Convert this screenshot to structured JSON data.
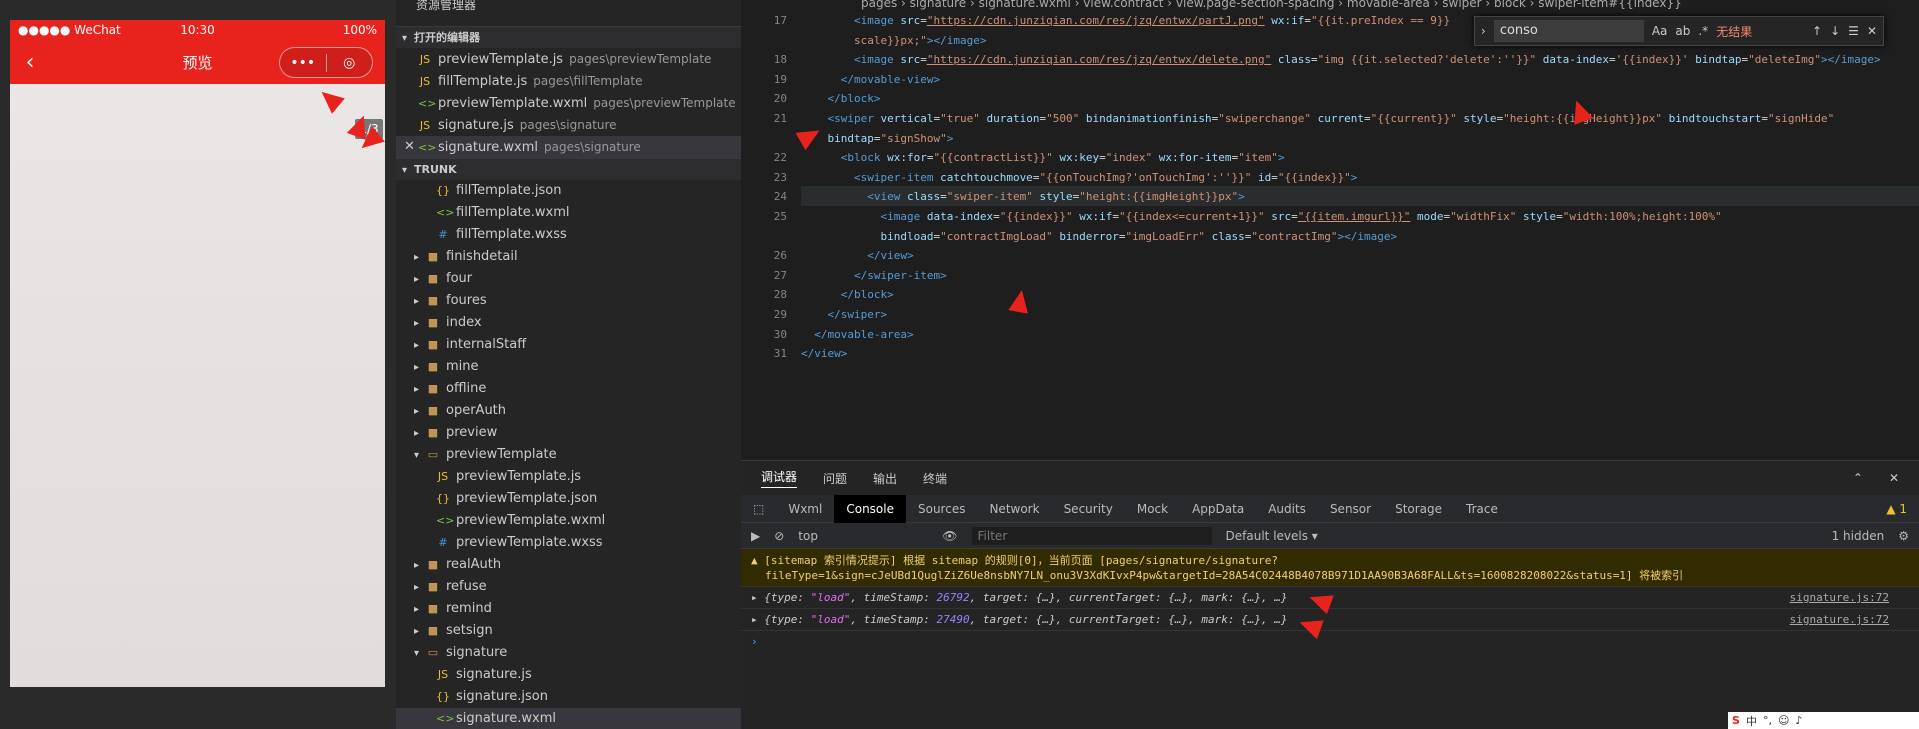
{
  "simulator": {
    "carrier": "●●●●● WeChat",
    "time": "10:30",
    "battery": "100%",
    "title": "预览",
    "capsule_more": "•••",
    "capsule_close": "◎",
    "counter": "1/3"
  },
  "explorer": {
    "title": "资源管理器",
    "open_editors_label": "打开的编辑器",
    "open_editors": [
      {
        "name": "previewTemplate.js",
        "path": "pages\\previewTemplate",
        "type": "js"
      },
      {
        "name": "fillTemplate.js",
        "path": "pages\\fillTemplate",
        "type": "js"
      },
      {
        "name": "previewTemplate.wxml",
        "path": "pages\\previewTemplate",
        "type": "wxml"
      },
      {
        "name": "signature.js",
        "path": "pages\\signature",
        "type": "js"
      },
      {
        "name": "signature.wxml",
        "path": "pages\\signature",
        "type": "wxml"
      }
    ],
    "trunk_label": "TRUNK",
    "tree": [
      {
        "name": "fillTemplate.json",
        "kind": "json",
        "indent": 2
      },
      {
        "name": "fillTemplate.wxml",
        "kind": "wxml",
        "indent": 2
      },
      {
        "name": "fillTemplate.wxss",
        "kind": "wxss",
        "indent": 2
      },
      {
        "name": "finishdetail",
        "kind": "folder",
        "indent": 1
      },
      {
        "name": "four",
        "kind": "folder",
        "indent": 1
      },
      {
        "name": "foures",
        "kind": "folder",
        "indent": 1
      },
      {
        "name": "index",
        "kind": "folder",
        "indent": 1
      },
      {
        "name": "internalStaff",
        "kind": "folder",
        "indent": 1
      },
      {
        "name": "mine",
        "kind": "folder",
        "indent": 1
      },
      {
        "name": "offline",
        "kind": "folder",
        "indent": 1
      },
      {
        "name": "operAuth",
        "kind": "folder",
        "indent": 1
      },
      {
        "name": "preview",
        "kind": "folder",
        "indent": 1
      },
      {
        "name": "previewTemplate",
        "kind": "folder-open",
        "indent": 1
      },
      {
        "name": "previewTemplate.js",
        "kind": "js",
        "indent": 2
      },
      {
        "name": "previewTemplate.json",
        "kind": "json",
        "indent": 2
      },
      {
        "name": "previewTemplate.wxml",
        "kind": "wxml",
        "indent": 2
      },
      {
        "name": "previewTemplate.wxss",
        "kind": "wxss",
        "indent": 2
      },
      {
        "name": "realAuth",
        "kind": "folder",
        "indent": 1
      },
      {
        "name": "refuse",
        "kind": "folder",
        "indent": 1
      },
      {
        "name": "remind",
        "kind": "folder",
        "indent": 1
      },
      {
        "name": "setsign",
        "kind": "folder",
        "indent": 1
      },
      {
        "name": "signature",
        "kind": "folder-open",
        "indent": 1
      },
      {
        "name": "signature.js",
        "kind": "js",
        "indent": 2
      },
      {
        "name": "signature.json",
        "kind": "json",
        "indent": 2
      },
      {
        "name": "signature.wxml",
        "kind": "wxml",
        "indent": 2
      }
    ]
  },
  "editor": {
    "breadcrumb": "pages › signature › signature.wxml › view.contract › view.page-section-spacing › movable-area › swiper › block › swiper-item#{{index}}",
    "find_value": "conso",
    "find_result": "无结果",
    "lines": [
      {
        "n": "17",
        "html": "        <span class='t'>&lt;image</span> <span class='a'>src</span>=<span class='u'>\"https://cdn.junziqian.com/res/jzq/entwx/partJ.png\"</span> <span class='a'>wx:if</span>=<span class='s'>\"{{it.preIndex == 9}}</span>"
      },
      {
        "n": "",
        "html": "        <span class='s'>scale}}px;\"</span><span class='t'>&gt;&lt;/image&gt;</span>"
      },
      {
        "n": "18",
        "html": "        <span class='t'>&lt;image</span> <span class='a'>src</span>=<span class='u'>\"https://cdn.junziqian.com/res/jzq/entwx/delete.png\"</span> <span class='a'>class</span>=<span class='s'>\"img {{it.selected?'delete':''}}\"</span> <span class='a'>data-index</span>=<span class='s'>'{{index}}'</span> <span class='a'>bindtap</span>=<span class='s'>\"deleteImg\"</span><span class='t'>&gt;&lt;/image&gt;</span>"
      },
      {
        "n": "19",
        "html": "      <span class='t'>&lt;/movable-view&gt;</span>"
      },
      {
        "n": "20",
        "html": "    <span class='t'>&lt;/block&gt;</span>"
      },
      {
        "n": "21",
        "html": "    <span class='t'>&lt;swiper</span> <span class='a'>vertical</span>=<span class='s'>\"true\"</span> <span class='a'>duration</span>=<span class='s'>\"500\"</span> <span class='a'>bindanimationfinish</span>=<span class='s'>\"swiperchange\"</span> <span class='a'>current</span>=<span class='s'>\"{{current}}\"</span> <span class='a'>style</span>=<span class='s'>\"height:{{imgHeight}}px\"</span> <span class='a'>bindtouchstart</span>=<span class='s'>\"signHide\"</span>"
      },
      {
        "n": "",
        "html": "    <span class='a'>bindtap</span>=<span class='s'>\"signShow\"</span><span class='t'>&gt;</span>"
      },
      {
        "n": "22",
        "html": "      <span class='t'>&lt;block</span> <span class='a'>wx:for</span>=<span class='s'>\"{{contractList}}\"</span> <span class='a'>wx:key</span>=<span class='s'>\"index\"</span> <span class='a'>wx:for-item</span>=<span class='s'>\"item\"</span><span class='t'>&gt;</span>"
      },
      {
        "n": "23",
        "html": "        <span class='t'>&lt;swiper-item</span> <span class='a'>catchtouchmove</span>=<span class='s'>\"{{onTouchImg?'onTouchImg':''}}\"</span> <span class='a'>id</span>=<span class='s'>\"{{index}}\"</span><span class='t'>&gt;</span>"
      },
      {
        "n": "24",
        "html": "          <span class='t'>&lt;view</span> <span class='a'>class</span>=<span class='s'>\"swiper-item\"</span> <span class='a'>style</span>=<span class='s'>\"height:{{imgHeight}}px\"</span><span class='t'>&gt;</span>"
      },
      {
        "n": "25",
        "html": "            <span class='t'>&lt;image</span> <span class='a'>data-index</span>=<span class='s'>\"{{index}}\"</span> <span class='a'>wx:if</span>=<span class='s'>\"{{index&lt;=current+1}}\"</span> <span class='a'>src</span>=<span class='u'>\"{{item.imgurl}}\"</span> <span class='a'>mode</span>=<span class='s'>\"widthFix\"</span> <span class='a'>style</span>=<span class='s'>\"width:100%;height:100%\"</span>"
      },
      {
        "n": "",
        "html": "            <span class='a'>bindload</span>=<span class='s'>\"contractImgLoad\"</span> <span class='a'>binderror</span>=<span class='s'>\"imgLoadErr\"</span> <span class='a'>class</span>=<span class='s'>\"contractImg\"</span><span class='t'>&gt;&lt;/image&gt;</span>"
      },
      {
        "n": "26",
        "html": "          <span class='t'>&lt;/view&gt;</span>"
      },
      {
        "n": "27",
        "html": "        <span class='t'>&lt;/swiper-item&gt;</span>"
      },
      {
        "n": "28",
        "html": "      <span class='t'>&lt;/block&gt;</span>"
      },
      {
        "n": "29",
        "html": "    <span class='t'>&lt;/swiper&gt;</span>"
      },
      {
        "n": "30",
        "html": "  <span class='t'>&lt;/movable-area&gt;</span>"
      },
      {
        "n": "31",
        "html": "<span class='t'>&lt;/view&gt;</span>"
      }
    ]
  },
  "panel": {
    "tabs": [
      "调试器",
      "问题",
      "输出",
      "终端"
    ],
    "devtools_tabs": [
      "Wxml",
      "Console",
      "Sources",
      "Network",
      "Security",
      "Mock",
      "AppData",
      "Audits",
      "Sensor",
      "Storage",
      "Trace"
    ],
    "warn_count": "1",
    "context": "top",
    "filter_placeholder": "Filter",
    "levels": "Default levels ▾",
    "hidden": "1 hidden",
    "warn_line1": "[sitemap 索引情况提示] 根据 sitemap 的规则[0]，当前页面 [pages/signature/signature?",
    "warn_line2": "fileType=1&sign=cJeUBd1QuglZiZ6Ue8nsbNY7LN_onu3V3XdKIvxP4pw&targetId=28A54C02448B4078B971D1AA90B3A68FALL&ts=1600828208022&status=1] 将被索引",
    "logs": [
      {
        "type": "\"load\"",
        "timeStamp": "26792",
        "src": "signature.js:72"
      },
      {
        "type": "\"load\"",
        "timeStamp": "27490",
        "src": "signature.js:72"
      }
    ]
  },
  "colors": {
    "brand": "#e8231e",
    "arrow": "#e8231e"
  }
}
